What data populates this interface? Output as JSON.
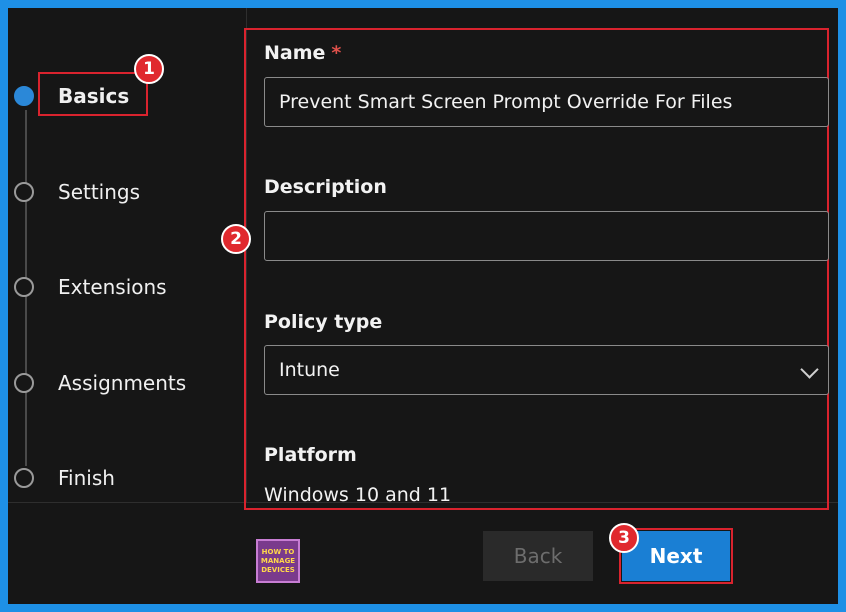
{
  "steps": [
    {
      "label": "Basics",
      "active": true
    },
    {
      "label": "Settings",
      "active": false
    },
    {
      "label": "Extensions",
      "active": false
    },
    {
      "label": "Assignments",
      "active": false
    },
    {
      "label": "Finish",
      "active": false
    }
  ],
  "form": {
    "name_label": "Name",
    "required_mark": "*",
    "name_value": "Prevent Smart Screen Prompt Override For Files",
    "description_label": "Description",
    "description_value": "",
    "policy_type_label": "Policy type",
    "policy_type_value": "Intune",
    "platform_label": "Platform",
    "platform_value": "Windows 10 and 11"
  },
  "footer": {
    "back_label": "Back",
    "next_label": "Next",
    "logo_lines": [
      "HOW TO",
      "MANAGE",
      "DEVICES"
    ]
  },
  "annotations": {
    "badge1": "1",
    "badge2": "2",
    "badge3": "3"
  },
  "colors": {
    "accent": "#1a7fd4",
    "highlight": "#d9232e",
    "background": "#161616"
  }
}
